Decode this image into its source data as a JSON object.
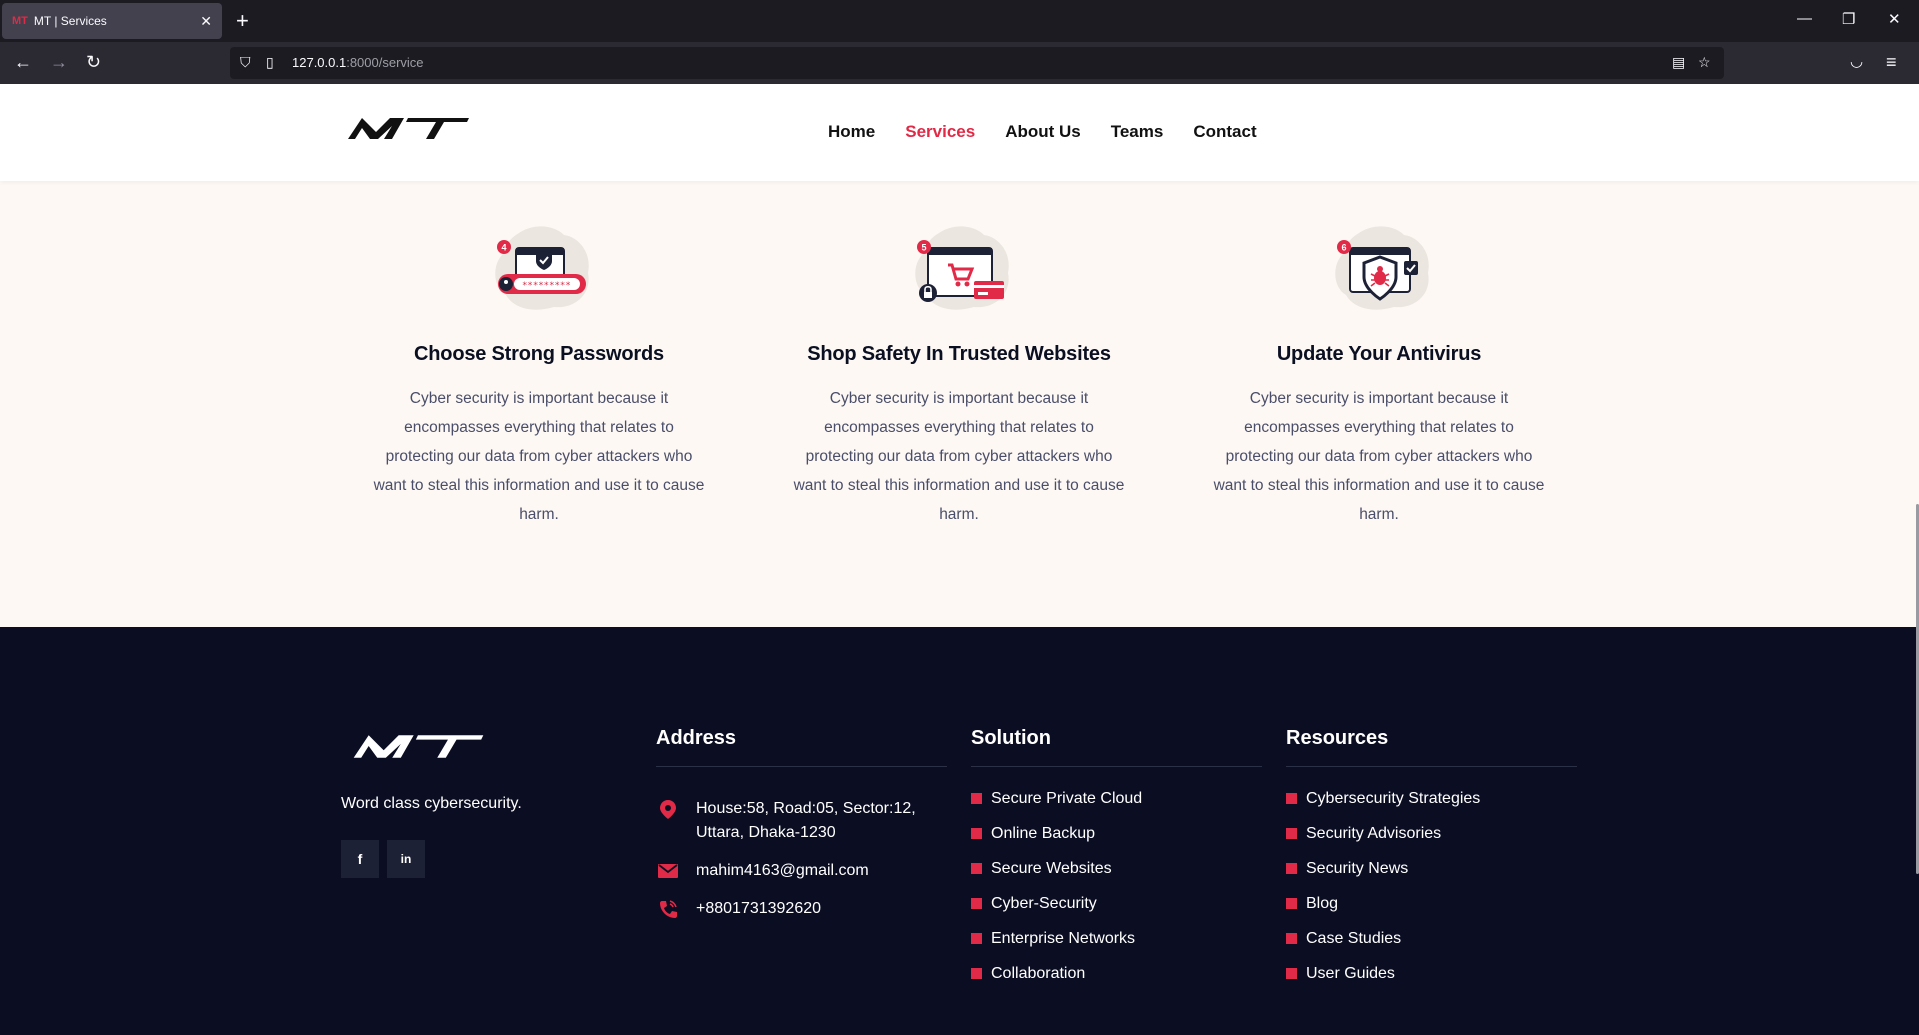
{
  "browser": {
    "tab_favicon": "MT",
    "tab_title": "MT | Services",
    "url_host": "127.0.0.1",
    "url_path": ":8000/service"
  },
  "header": {
    "logo_text": "MT",
    "menu": [
      {
        "label": "Home",
        "active": false
      },
      {
        "label": "Services",
        "active": true
      },
      {
        "label": "About Us",
        "active": false
      },
      {
        "label": "Teams",
        "active": false
      },
      {
        "label": "Contact",
        "active": false
      }
    ]
  },
  "services": [
    {
      "badge": "4",
      "icon": "password-icon",
      "title": "Choose Strong Passwords",
      "text": "Cyber security is important because it encompasses everything that relates to protecting our data from cyber attackers who want to steal this information and use it to cause harm."
    },
    {
      "badge": "5",
      "icon": "secure-shopping-icon",
      "title": "Shop Safety In Trusted Websites",
      "text": "Cyber security is important because it encompasses everything that relates to protecting our data from cyber attackers who want to steal this information and use it to cause harm."
    },
    {
      "badge": "6",
      "icon": "antivirus-shield-icon",
      "title": "Update Your Antivirus",
      "text": "Cyber security is important because it encompasses everything that relates to protecting our data from cyber attackers who want to steal this information and use it to cause harm."
    }
  ],
  "footer": {
    "logo_text": "MT",
    "tagline": "Word class cybersecurity.",
    "social": [
      "f",
      "in"
    ],
    "address": {
      "title": "Address",
      "location": "House:58, Road:05, Sector:12, Uttara, Dhaka-1230",
      "email": "mahim4163@gmail.com",
      "phone": "+8801731392620"
    },
    "solution": {
      "title": "Solution",
      "items": [
        "Secure Private Cloud",
        "Online Backup",
        "Secure Websites",
        "Cyber-Security",
        "Enterprise Networks",
        "Collaboration"
      ]
    },
    "resources": {
      "title": "Resources",
      "items": [
        "Cybersecurity Strategies",
        "Security Advisories",
        "Security News",
        "Blog",
        "Case Studies",
        "User Guides"
      ]
    }
  },
  "colors": {
    "accent": "#e02a47",
    "footer_bg": "#0b0e22",
    "section_bg": "#fdf8f3"
  }
}
